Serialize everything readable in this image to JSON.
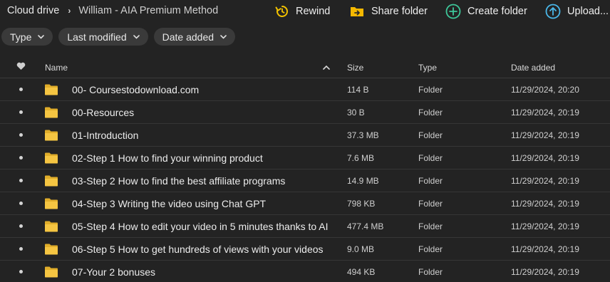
{
  "breadcrumb": {
    "root": "Cloud drive",
    "current": "William - AIA Premium Method"
  },
  "actions": {
    "rewind": "Rewind",
    "share_folder": "Share folder",
    "create_folder": "Create folder",
    "upload": "Upload..."
  },
  "filters": {
    "type": "Type",
    "last_modified": "Last modified",
    "date_added": "Date added"
  },
  "table": {
    "headers": {
      "name": "Name",
      "size": "Size",
      "type": "Type",
      "date_added": "Date added"
    },
    "rows": [
      {
        "name": "00- Coursestodownload.com",
        "size": "114 B",
        "type": "Folder",
        "date": "11/29/2024, 20:20"
      },
      {
        "name": "00-Resources",
        "size": "30 B",
        "type": "Folder",
        "date": "11/29/2024, 20:19"
      },
      {
        "name": "01-Introduction",
        "size": "37.3 MB",
        "type": "Folder",
        "date": "11/29/2024, 20:19"
      },
      {
        "name": "02-Step 1 How to find your winning product",
        "size": "7.6 MB",
        "type": "Folder",
        "date": "11/29/2024, 20:19"
      },
      {
        "name": "03-Step 2 How to find the best affiliate programs",
        "size": "14.9 MB",
        "type": "Folder",
        "date": "11/29/2024, 20:19"
      },
      {
        "name": "04-Step 3 Writing the video using Chat GPT",
        "size": "798 KB",
        "type": "Folder",
        "date": "11/29/2024, 20:19"
      },
      {
        "name": "05-Step 4 How to edit your video in 5 minutes thanks to AI",
        "size": "477.4 MB",
        "type": "Folder",
        "date": "11/29/2024, 20:19"
      },
      {
        "name": "06-Step 5 How to get hundreds of views with your videos",
        "size": "9.0 MB",
        "type": "Folder",
        "date": "11/29/2024, 20:19"
      },
      {
        "name": "07-Your 2 bonuses",
        "size": "494 KB",
        "type": "Folder",
        "date": "11/29/2024, 20:19"
      }
    ]
  },
  "colors": {
    "background": "#232323",
    "folder": "#f5c542",
    "folder_tab": "#e0ad2a",
    "create_accent": "#3ec79a",
    "upload_accent": "#4ab8ea",
    "rewind_accent": "#f2c200"
  },
  "icons": {
    "rewind": "rewind-icon",
    "share": "share-folder-icon",
    "create": "create-folder-icon",
    "upload": "upload-icon",
    "favourite_header": "heart-icon",
    "sort": "sort-ascending-icon",
    "row": "folder-icon"
  }
}
